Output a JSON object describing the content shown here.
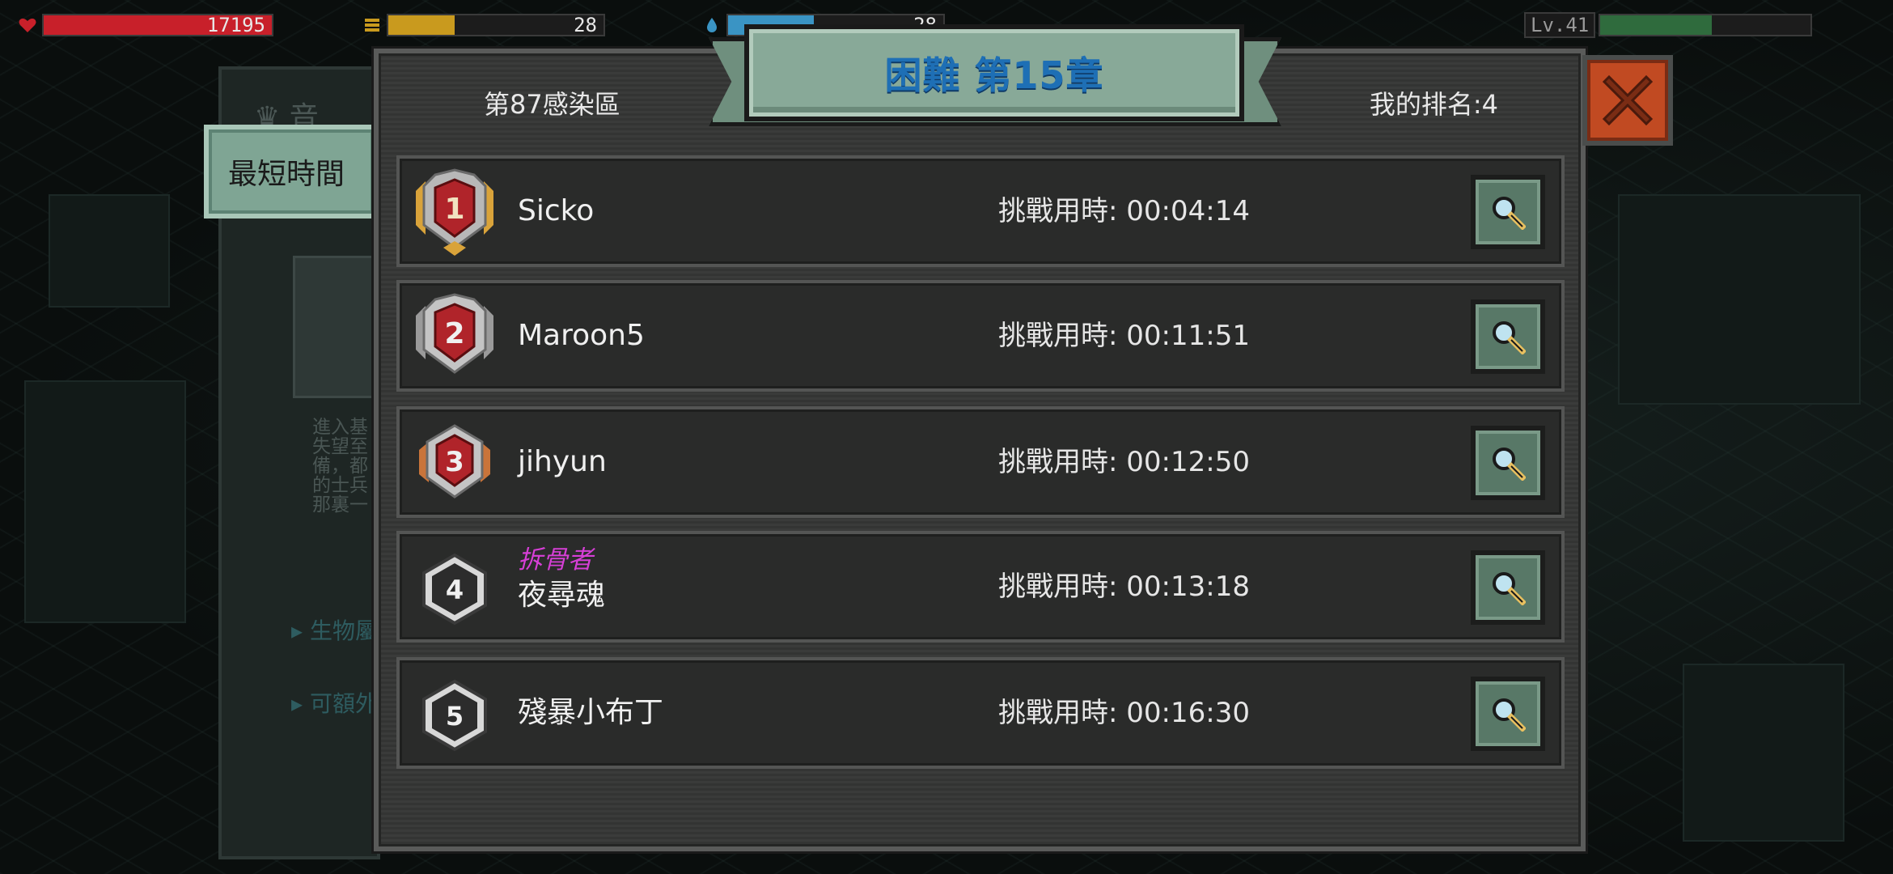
{
  "hud": {
    "hp_value": "17195",
    "hp_fill": 1.0,
    "coins_value": "28",
    "coins_fill": 0.31,
    "water_value": "28",
    "level_label": "Lv.41",
    "xp_fill": 0.53,
    "colors": {
      "hp": "#c8202a",
      "coins": "#c99a1e",
      "water": "#3a94c4",
      "xp": "#2f6b3d"
    }
  },
  "back_panel": {
    "crest_text": "音",
    "desc_lines": [
      "進入基",
      "失望至",
      "備，都",
      "的士兵",
      "那裏一"
    ],
    "link_1": "生物屬",
    "link_2": "可額外"
  },
  "side_tab": {
    "label": "最短時間"
  },
  "leaderboard": {
    "title": "困難 第15章",
    "zone": "第87感染區",
    "my_rank": "我的排名:4",
    "rows": [
      {
        "rank": "1",
        "badge": "gold-rank-badge",
        "name": "Sicko",
        "title_tag": "",
        "time": "挑戰用時: 00:04:14"
      },
      {
        "rank": "2",
        "badge": "silver-rank-badge",
        "name": "Maroon5",
        "title_tag": "",
        "time": "挑戰用時: 00:11:51"
      },
      {
        "rank": "3",
        "badge": "bronze-rank-badge",
        "name": "jihyun",
        "title_tag": "",
        "time": "挑戰用時: 00:12:50"
      },
      {
        "rank": "4",
        "badge": "plain-rank-badge",
        "name": "夜尋魂",
        "title_tag": "拆骨者",
        "time": "挑戰用時: 00:13:18"
      },
      {
        "rank": "5",
        "badge": "plain-rank-badge",
        "name": "殘暴小布丁",
        "title_tag": "",
        "time": "挑戰用時: 00:16:30"
      }
    ],
    "colors": {
      "title": "#1e6fb5",
      "title_tag": "#d63fd6",
      "close": "#c14a22"
    }
  },
  "icons": {
    "close": "close-x-icon",
    "search": "magnifier-icon",
    "hp": "heart-icon",
    "coins": "coin-stack-icon",
    "water": "water-drop-icon"
  }
}
